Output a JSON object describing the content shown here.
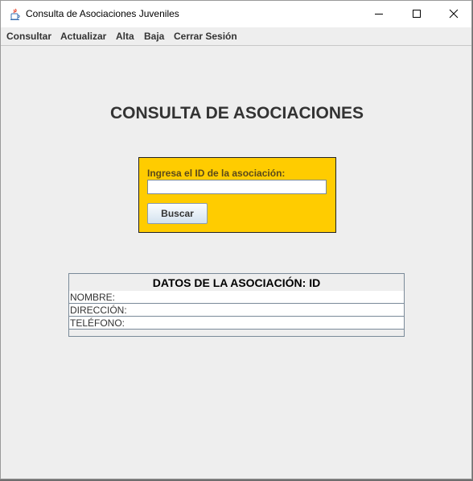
{
  "window": {
    "title": "Consulta de Asociaciones Juveniles",
    "app_icon": "java-cup-icon",
    "controls": {
      "minimize": "minimize-icon",
      "maximize": "maximize-icon",
      "close": "close-icon"
    }
  },
  "menu": {
    "items": [
      {
        "label": "Consultar"
      },
      {
        "label": "Actualizar"
      },
      {
        "label": "Alta"
      },
      {
        "label": "Baja"
      },
      {
        "label": "Cerrar Sesión"
      }
    ]
  },
  "main": {
    "title": "CONSULTA DE ASOCIACIONES"
  },
  "search": {
    "label": "Ingresa el ID de la asociación:",
    "value": "",
    "placeholder": "",
    "button_label": "Buscar",
    "panel_color": "#ffcc00"
  },
  "details": {
    "header": "DATOS DE LA ASOCIACIÓN: ID",
    "rows": [
      {
        "label": "NOMBRE:"
      },
      {
        "label": "DIRECCIÓN:"
      },
      {
        "label": "TELÉFONO:"
      }
    ]
  }
}
